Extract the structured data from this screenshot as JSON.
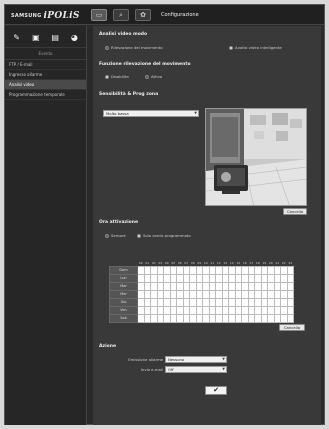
{
  "header": {
    "brand_small": "SAMSUNG",
    "brand_large": "iPOLiS",
    "title": "Configurazione"
  },
  "sidebar": {
    "heading": "Evento",
    "items": [
      {
        "label": "FTP / E-mail"
      },
      {
        "label": "Ingresso allarme"
      },
      {
        "label": "Analisi video"
      },
      {
        "label": "Programmazione temporale"
      }
    ]
  },
  "main": {
    "mode_title": "Analisi video modo",
    "mode_options": [
      "Rilevazione del movimento",
      "Analisi video intelligente"
    ],
    "func_title": "Funzione rilevazione del movimento",
    "func_options": [
      "Disabilita",
      "Attiva"
    ],
    "sens_title": "Sensibilità & Prog zona",
    "sens_select": "Molto bassa",
    "cancel_label": "Cancella",
    "sched_title": "Ora attivazione",
    "sched_options": [
      "Sempre",
      "Solo orario programmato"
    ],
    "hours": [
      "00",
      "01",
      "02",
      "03",
      "04",
      "05",
      "06",
      "07",
      "08",
      "09",
      "10",
      "11",
      "12",
      "13",
      "14",
      "15",
      "16",
      "17",
      "18",
      "19",
      "20",
      "21",
      "22",
      "23"
    ],
    "days": [
      "Dom",
      "Lun",
      "Mar",
      "Mer",
      "Gio",
      "Ven",
      "Sab"
    ],
    "clear_label": "Cancella",
    "action_title": "Azione",
    "alarm_out_label": "Emissione allarme",
    "alarm_out_value": "Nessuno",
    "email_label": "Invio e-mail",
    "email_value": "Off"
  }
}
